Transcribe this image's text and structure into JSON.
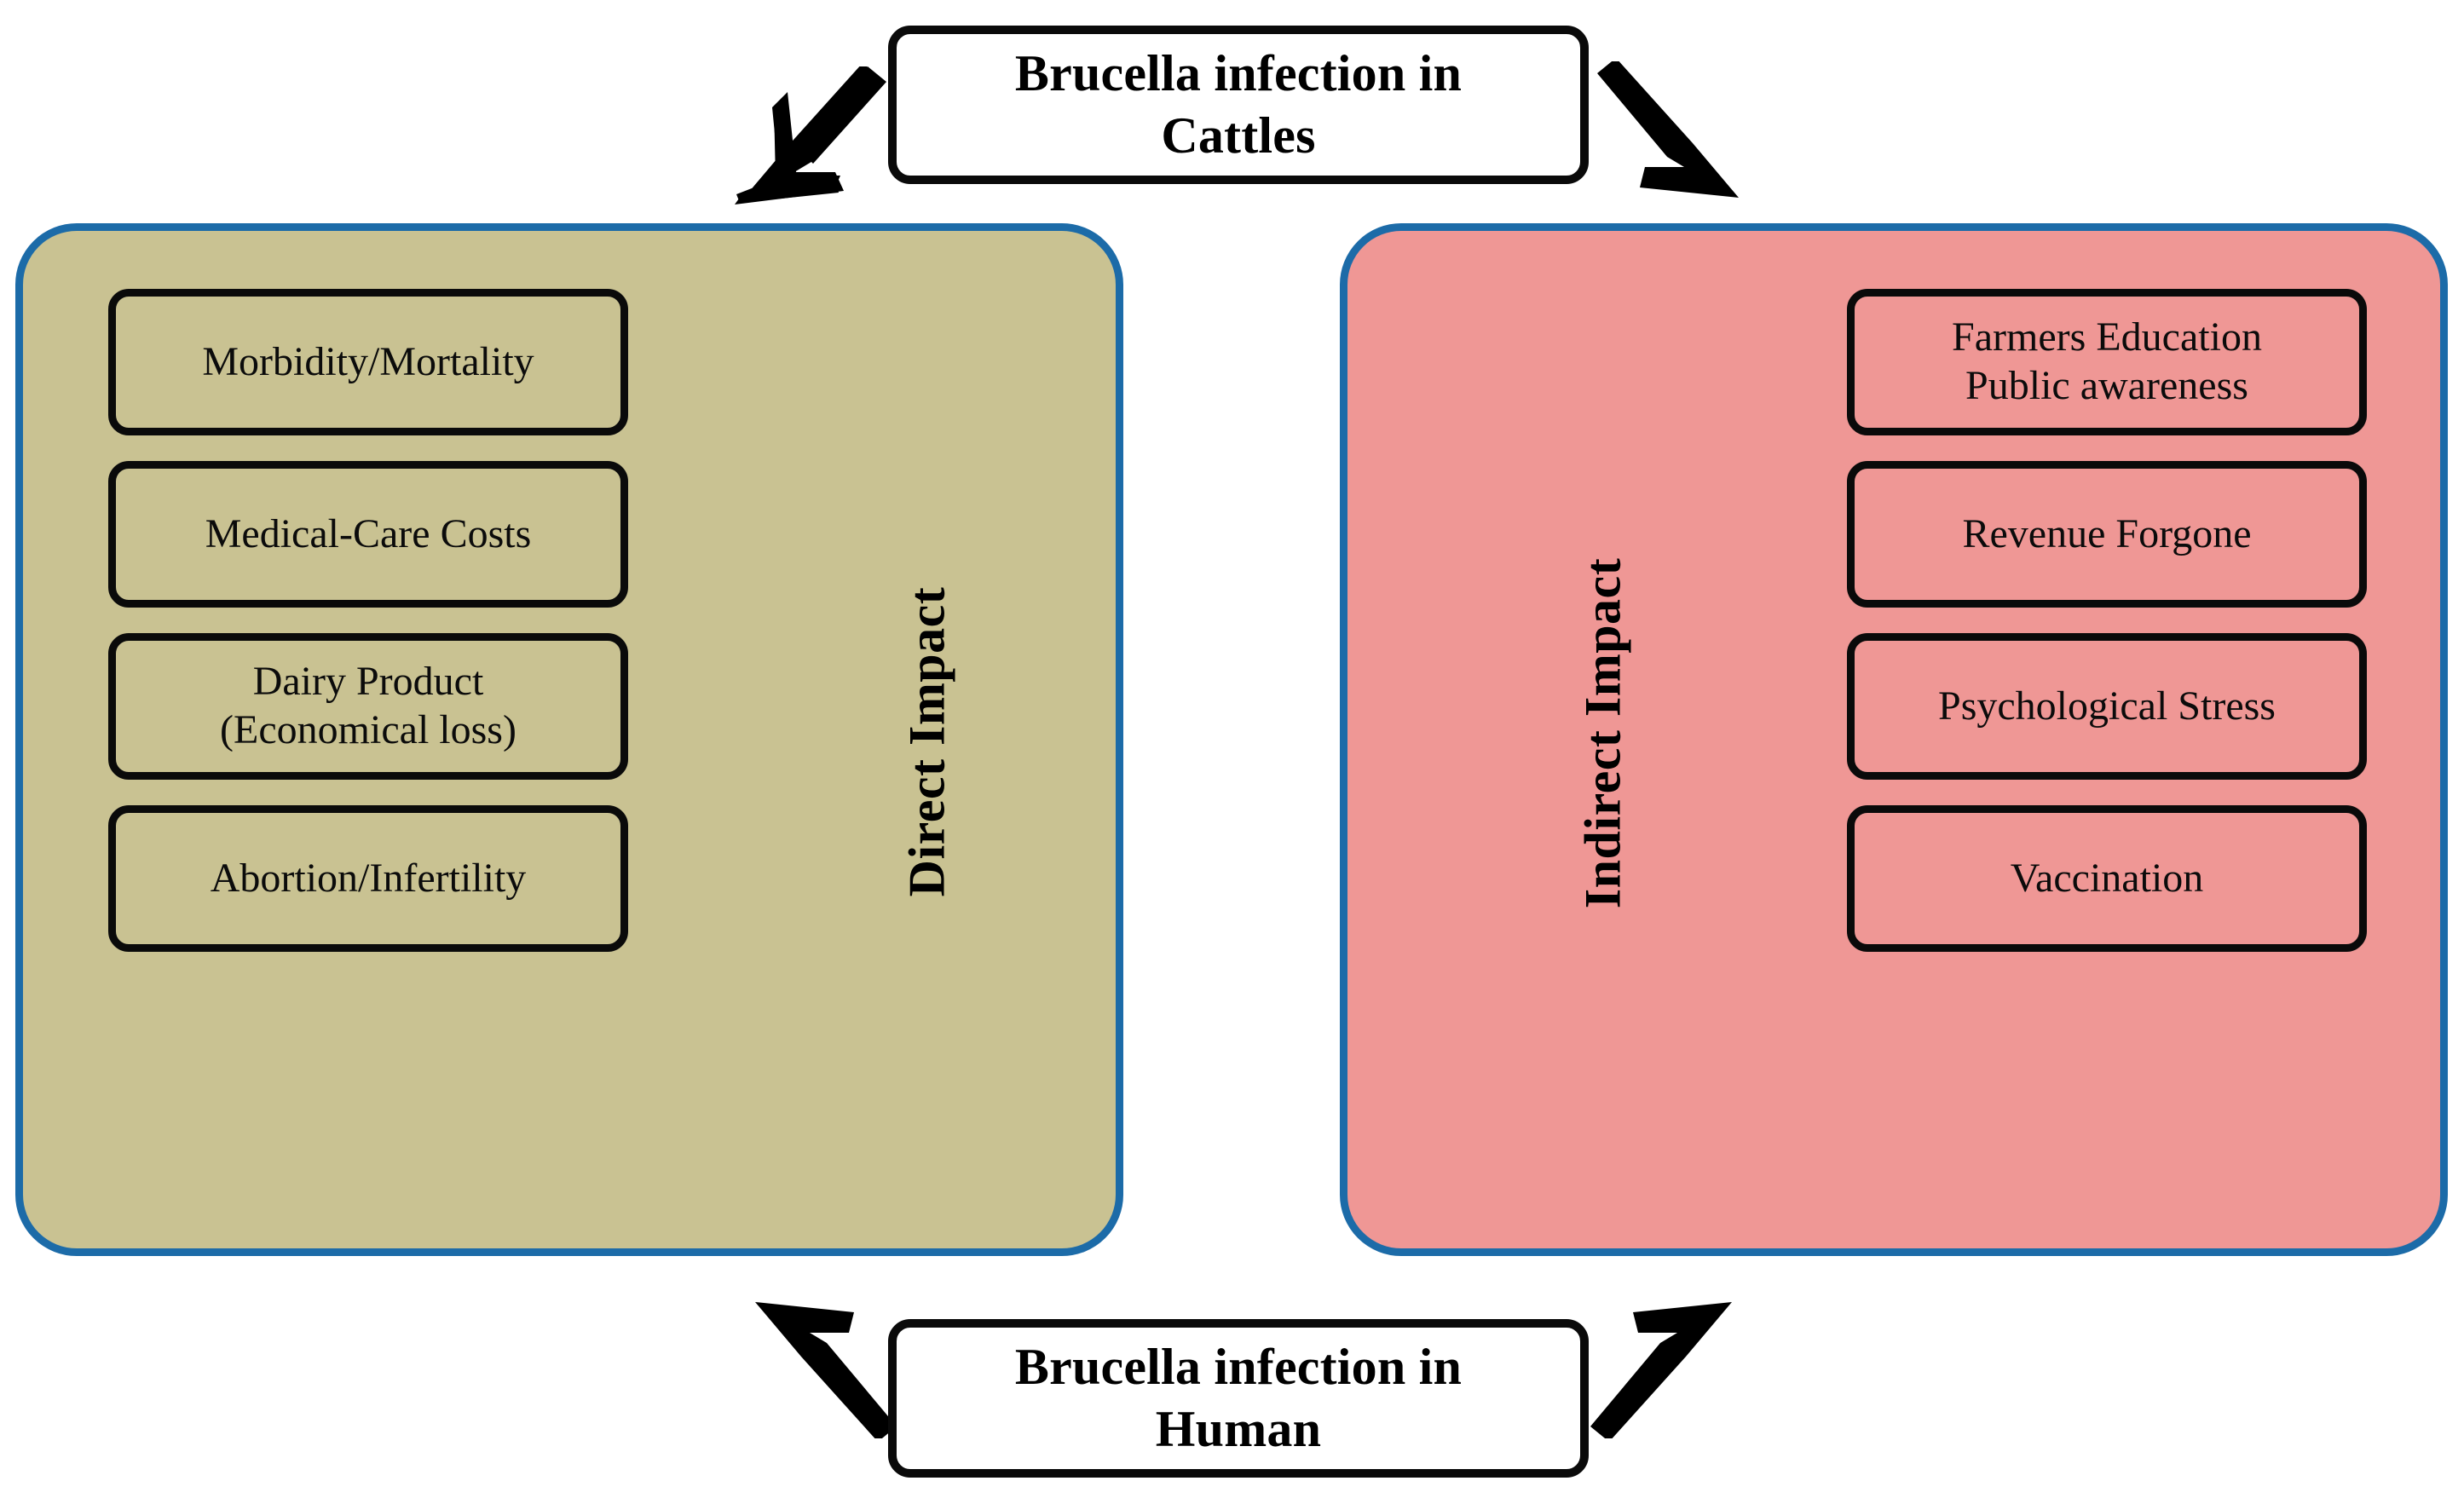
{
  "figure": {
    "title_top": {
      "line1": "Brucella infection in",
      "line2": "Cattles"
    },
    "title_bottom": {
      "line1": "Brucella infection in",
      "line2": "Human"
    }
  },
  "colors": {
    "panel_border": "#1C6BA8",
    "direct_panel_fill": "#C9C292",
    "indirect_panel_fill": "#EF9795",
    "box_border": "#0A0A0A",
    "box_fill": "#FFFFFF",
    "text": "#000000"
  },
  "panels": {
    "direct": {
      "label": "Direct Impact",
      "items": [
        {
          "line1": "Morbidity/Mortality",
          "line2": ""
        },
        {
          "line1": "Medical-Care Costs",
          "line2": ""
        },
        {
          "line1": "Dairy Product",
          "line2": "(Economical loss)"
        },
        {
          "line1": "Abortion/Infertility",
          "line2": ""
        }
      ]
    },
    "indirect": {
      "label": "Indirect Impact",
      "items": [
        {
          "line1": "Farmers Education",
          "line2": "Public awareness"
        },
        {
          "line1": "Revenue Forgone",
          "line2": ""
        },
        {
          "line1": "Psychological Stress",
          "line2": ""
        },
        {
          "line1": "Vaccination",
          "line2": ""
        }
      ]
    }
  },
  "arrows": [
    {
      "name": "top-left-arrow",
      "direction": "down-left"
    },
    {
      "name": "top-right-arrow",
      "direction": "down-right"
    },
    {
      "name": "bottom-left-arrow",
      "direction": "up-left"
    },
    {
      "name": "bottom-right-arrow",
      "direction": "up-right"
    }
  ]
}
